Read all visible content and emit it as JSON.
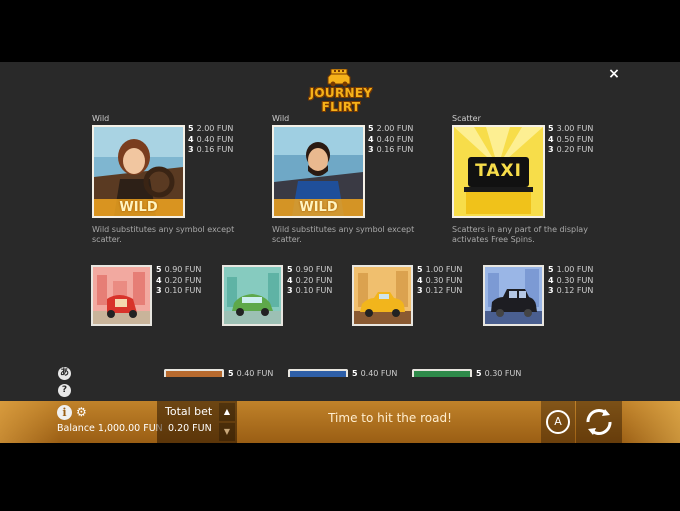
{
  "header": {
    "logo_text": "JOURNEY FLIRT",
    "close_glyph": "×"
  },
  "symbols_top": [
    {
      "label": "Wild",
      "image": "woman-driver-wild-symbol",
      "wild_text": "WILD",
      "payouts": [
        {
          "count": "5",
          "value": "2.00 FUN"
        },
        {
          "count": "4",
          "value": "0.40 FUN"
        },
        {
          "count": "3",
          "value": "0.16 FUN"
        }
      ],
      "description": "Wild substitutes any symbol except scatter."
    },
    {
      "label": "Wild",
      "image": "man-driver-wild-symbol",
      "wild_text": "WILD",
      "payouts": [
        {
          "count": "5",
          "value": "2.00 FUN"
        },
        {
          "count": "4",
          "value": "0.40 FUN"
        },
        {
          "count": "3",
          "value": "0.16 FUN"
        }
      ],
      "description": "Wild substitutes any symbol except scatter."
    },
    {
      "label": "Scatter",
      "image": "taxi-sign-scatter-symbol",
      "sign_text": "TAXI",
      "payouts": [
        {
          "count": "5",
          "value": "3.00 FUN"
        },
        {
          "count": "4",
          "value": "0.50 FUN"
        },
        {
          "count": "3",
          "value": "0.20 FUN"
        }
      ],
      "description": "Scatters in any part of the display activates Free Spins."
    }
  ],
  "symbols_mid": [
    {
      "image": "red-tuktuk-symbol",
      "payouts": [
        {
          "count": "5",
          "value": "0.90 FUN"
        },
        {
          "count": "4",
          "value": "0.20 FUN"
        },
        {
          "count": "3",
          "value": "0.10 FUN"
        }
      ]
    },
    {
      "image": "green-car-symbol",
      "payouts": [
        {
          "count": "5",
          "value": "0.90 FUN"
        },
        {
          "count": "4",
          "value": "0.20 FUN"
        },
        {
          "count": "3",
          "value": "0.10 FUN"
        }
      ]
    },
    {
      "image": "yellow-taxi-symbol",
      "payouts": [
        {
          "count": "5",
          "value": "1.00 FUN"
        },
        {
          "count": "4",
          "value": "0.30 FUN"
        },
        {
          "count": "3",
          "value": "0.12 FUN"
        }
      ]
    },
    {
      "image": "black-cab-symbol",
      "payouts": [
        {
          "count": "5",
          "value": "1.00 FUN"
        },
        {
          "count": "4",
          "value": "0.30 FUN"
        },
        {
          "count": "3",
          "value": "0.12 FUN"
        }
      ]
    }
  ],
  "symbols_bottom_partial": [
    {
      "image": "orange-symbol",
      "payout": {
        "count": "5",
        "value": "0.40 FUN"
      }
    },
    {
      "image": "blue-symbol",
      "payout": {
        "count": "5",
        "value": "0.40 FUN"
      }
    },
    {
      "image": "green-symbol",
      "payout": {
        "count": "5",
        "value": "0.30 FUN"
      }
    }
  ],
  "side_icons": [
    {
      "icon": "language-icon",
      "glyph": "あ"
    },
    {
      "icon": "help-icon",
      "glyph": "?"
    }
  ],
  "bottom_bar": {
    "info_glyph": "i",
    "gear_glyph": "⚙",
    "balance_text": "Balance 1,000.00 FUN",
    "total_bet_label": "Total bet",
    "total_bet_value": "0.20 FUN",
    "bet_up_glyph": "▲",
    "bet_down_glyph": "▼",
    "message": "Time to hit the road!",
    "auto_glyph": "A",
    "colors": {
      "bar": "#b07525",
      "accent": "#f6b21a",
      "panel": "#292929"
    }
  }
}
